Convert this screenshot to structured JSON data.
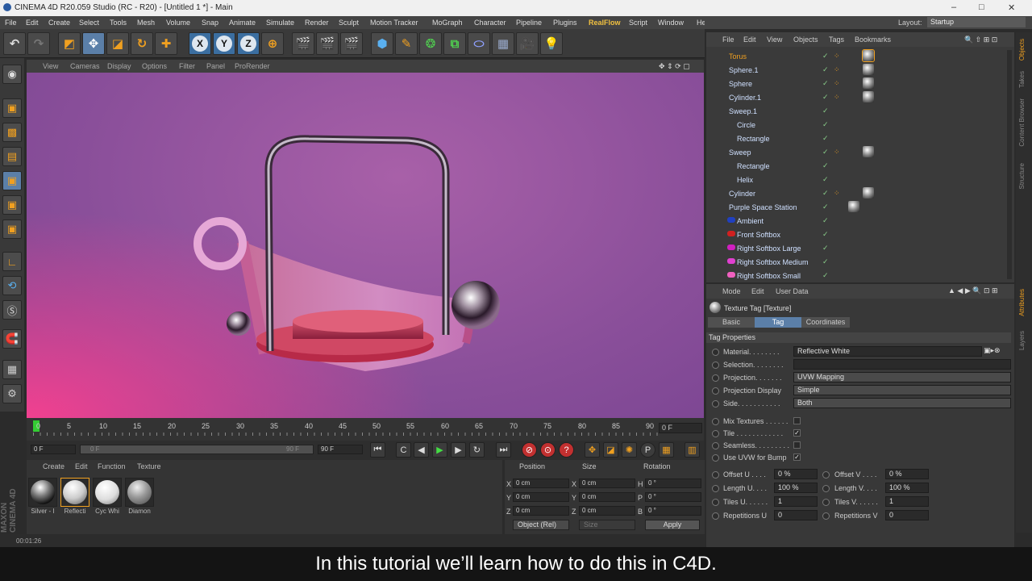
{
  "window": {
    "title": "CINEMA 4D R20.059 Studio (RC - R20) - [Untitled 1 *] - Main",
    "minimize": "–",
    "maximize": "□",
    "close": "✕"
  },
  "menu": [
    "File",
    "Edit",
    "Create",
    "Select",
    "Tools",
    "Mesh",
    "Volume",
    "Snap",
    "Animate",
    "Simulate",
    "Render",
    "Sculpt",
    "Motion Tracker",
    "MoGraph",
    "Character",
    "Pipeline",
    "Plugins",
    "RealFlow",
    "Script",
    "Window",
    "Help"
  ],
  "layout": {
    "label": "Layout:",
    "value": "Startup"
  },
  "axes": [
    "X",
    "Y",
    "Z"
  ],
  "viewport_menu": [
    "View",
    "Cameras",
    "Display",
    "Options",
    "Filter",
    "Panel",
    "ProRender"
  ],
  "timeline": {
    "ticks": [
      "0",
      "5",
      "10",
      "15",
      "20",
      "25",
      "30",
      "35",
      "40",
      "45",
      "50",
      "55",
      "60",
      "65",
      "70",
      "75",
      "80",
      "85",
      "90"
    ],
    "current": "0 F",
    "start": "0 F",
    "end_field": "90 F",
    "range_start": "0 F",
    "range_end": "90 F"
  },
  "material_menu": [
    "Create",
    "Edit",
    "Function",
    "Texture"
  ],
  "materials": [
    {
      "name": "Silver - I",
      "color": "#ddd"
    },
    {
      "name": "Reflecti",
      "color": "#eee"
    },
    {
      "name": "Cyc Whi",
      "color": "#f4f4f4"
    },
    {
      "name": "Diamon",
      "color": "#bbb"
    }
  ],
  "coords": {
    "headers": [
      "Position",
      "Size",
      "Rotation"
    ],
    "rows": [
      {
        "a": "X",
        "v1": "0 cm",
        "b": "X",
        "v2": "0 cm",
        "c": "H",
        "v3": "0 °"
      },
      {
        "a": "Y",
        "v1": "0 cm",
        "b": "Y",
        "v2": "0 cm",
        "c": "P",
        "v3": "0 °"
      },
      {
        "a": "Z",
        "v1": "0 cm",
        "b": "Z",
        "v2": "0 cm",
        "c": "B",
        "v3": "0 °"
      }
    ],
    "mode": "Object (Rel)",
    "size_mode": "Size",
    "apply": "Apply"
  },
  "status": {
    "time": "00:01:26"
  },
  "brand": "MAXON CINEMA 4D",
  "obj_menu": [
    "File",
    "Edit",
    "View",
    "Objects",
    "Tags",
    "Bookmarks"
  ],
  "objects": [
    {
      "name": "Torus",
      "color": "#f0a020",
      "hl": true
    },
    {
      "name": "Sphere.1"
    },
    {
      "name": "Sphere"
    },
    {
      "name": "Cylinder.1"
    },
    {
      "name": "Sweep.1"
    },
    {
      "name": "Circle"
    },
    {
      "name": "Rectangle"
    },
    {
      "name": "Sweep"
    },
    {
      "name": "Rectangle"
    },
    {
      "name": "Helix"
    },
    {
      "name": "Cylinder"
    },
    {
      "name": "Purple Space Station"
    },
    {
      "name": "Ambient"
    },
    {
      "name": "Front Softbox"
    },
    {
      "name": "Right Softbox Large"
    },
    {
      "name": "Right Softbox Medium"
    },
    {
      "name": "Right Softbox Small"
    }
  ],
  "side_tabs": [
    "Objects",
    "Takes",
    "Content Browser",
    "Structure",
    "Attributes",
    "Layers"
  ],
  "attr": {
    "menu": [
      "Mode",
      "Edit",
      "User Data"
    ],
    "title": "Texture Tag [Texture]",
    "tabs": [
      "Basic",
      "Tag",
      "Coordinates"
    ],
    "section": "Tag Properties",
    "material": {
      "label": "Material. . . . . . . .",
      "value": "Reflective White"
    },
    "selection": {
      "label": "Selection. . . . . . . .",
      "value": ""
    },
    "projection": {
      "label": "Projection. . . . . . .",
      "value": "UVW Mapping"
    },
    "proj_display": {
      "label": "Projection Display",
      "value": "Simple"
    },
    "side": {
      "label": "Side. . . . . . . . . . .",
      "value": "Both"
    },
    "mix": "Mix Textures . . . . . .",
    "tile": "Tile . . . . . . . . . . . .",
    "seamless": "Seamless. . . . . . . . .",
    "uvw_bump": "Use UVW for Bump",
    "offset_u": {
      "label": "Offset U . . . .",
      "value": "0 %"
    },
    "offset_v": {
      "label": "Offset V . . . .",
      "value": "0 %"
    },
    "length_u": {
      "label": "Length U. . . .",
      "value": "100 %"
    },
    "length_v": {
      "label": "Length V. . . .",
      "value": "100 %"
    },
    "tiles_u": {
      "label": "Tiles U. . . . . .",
      "value": "1"
    },
    "tiles_v": {
      "label": "Tiles V. . . . . .",
      "value": "1"
    },
    "rep_u": {
      "label": "Repetitions U",
      "value": "0"
    },
    "rep_v": {
      "label": "Repetitions V",
      "value": "0"
    }
  },
  "subtitle": "In this tutorial we’ll learn how to do this in C4D."
}
